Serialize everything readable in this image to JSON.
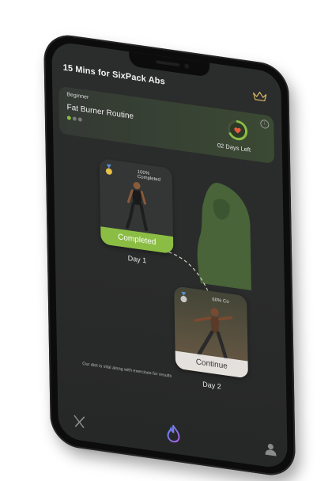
{
  "header": {
    "title": "15 Mins for SixPack Abs",
    "premium_icon": "crown-icon"
  },
  "routine": {
    "level": "Beginner",
    "name": "Fat Burner Routine",
    "difficulty_total": 3,
    "difficulty_active": 1,
    "days_left": "02 Days Left",
    "ring_icon": "heart-timer-icon",
    "info_icon": "info-icon"
  },
  "days": [
    {
      "label": "Day 1",
      "progress_text": "100% Completed",
      "progress": 1.0,
      "button": "Completed"
    },
    {
      "label": "Day 2",
      "progress_text": "60% Co",
      "progress": 0.6,
      "button": "Continue"
    }
  ],
  "footer_tip": "Our diet is vital along with exercises for results",
  "tabs": [
    {
      "name": "diet",
      "icon": "fork-knife-icon"
    },
    {
      "name": "workout",
      "icon": "flame-icon"
    },
    {
      "name": "profile",
      "icon": "user-icon"
    }
  ],
  "colors": {
    "accent": "#8bbd44",
    "background": "#2b2d2c",
    "card": "#333634"
  }
}
